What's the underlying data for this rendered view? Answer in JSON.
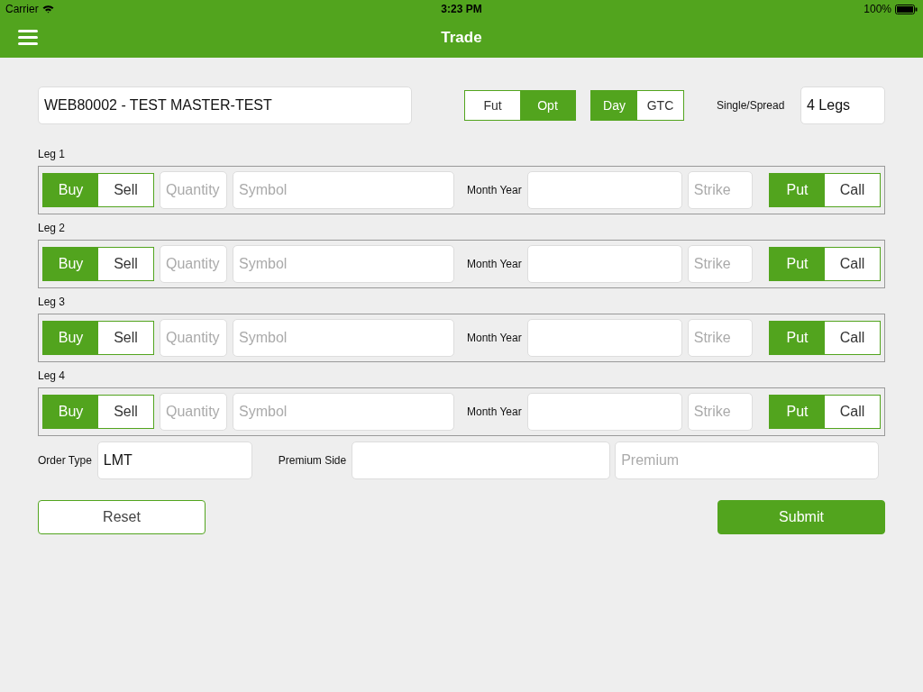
{
  "status_bar": {
    "carrier": "Carrier",
    "time": "3:23 PM",
    "battery": "100%"
  },
  "nav": {
    "title": "Trade"
  },
  "account": {
    "value": "WEB80002 - TEST MASTER-TEST"
  },
  "instrument": [
    {
      "label": "Fut",
      "selected": false
    },
    {
      "label": "Opt",
      "selected": true
    }
  ],
  "duration": [
    {
      "label": "Day",
      "selected": true
    },
    {
      "label": "GTC",
      "selected": false
    }
  ],
  "single_spread": {
    "label": "Single/Spread",
    "value": "4 Legs"
  },
  "legs": [
    {
      "title": "Leg 1",
      "side": [
        {
          "label": "Buy",
          "selected": true
        },
        {
          "label": "Sell",
          "selected": false
        }
      ],
      "quantity": {
        "placeholder": "Quantity"
      },
      "symbol": {
        "placeholder": "Symbol"
      },
      "month_year": {
        "label": "Month Year"
      },
      "strike": {
        "placeholder": "Strike"
      },
      "option_type": [
        {
          "label": "Put",
          "selected": true
        },
        {
          "label": "Call",
          "selected": false
        }
      ]
    },
    {
      "title": "Leg 2",
      "side": [
        {
          "label": "Buy",
          "selected": true
        },
        {
          "label": "Sell",
          "selected": false
        }
      ],
      "quantity": {
        "placeholder": "Quantity"
      },
      "symbol": {
        "placeholder": "Symbol"
      },
      "month_year": {
        "label": "Month Year"
      },
      "strike": {
        "placeholder": "Strike"
      },
      "option_type": [
        {
          "label": "Put",
          "selected": true
        },
        {
          "label": "Call",
          "selected": false
        }
      ]
    },
    {
      "title": "Leg 3",
      "side": [
        {
          "label": "Buy",
          "selected": true
        },
        {
          "label": "Sell",
          "selected": false
        }
      ],
      "quantity": {
        "placeholder": "Quantity"
      },
      "symbol": {
        "placeholder": "Symbol"
      },
      "month_year": {
        "label": "Month Year"
      },
      "strike": {
        "placeholder": "Strike"
      },
      "option_type": [
        {
          "label": "Put",
          "selected": true
        },
        {
          "label": "Call",
          "selected": false
        }
      ]
    },
    {
      "title": "Leg 4",
      "side": [
        {
          "label": "Buy",
          "selected": true
        },
        {
          "label": "Sell",
          "selected": false
        }
      ],
      "quantity": {
        "placeholder": "Quantity"
      },
      "symbol": {
        "placeholder": "Symbol"
      },
      "month_year": {
        "label": "Month Year"
      },
      "strike": {
        "placeholder": "Strike"
      },
      "option_type": [
        {
          "label": "Put",
          "selected": true
        },
        {
          "label": "Call",
          "selected": false
        }
      ]
    }
  ],
  "order_type": {
    "label": "Order Type",
    "value": "LMT"
  },
  "premium_side": {
    "label": "Premium Side"
  },
  "premium": {
    "placeholder": "Premium"
  },
  "buttons": {
    "reset": "Reset",
    "submit": "Submit"
  }
}
